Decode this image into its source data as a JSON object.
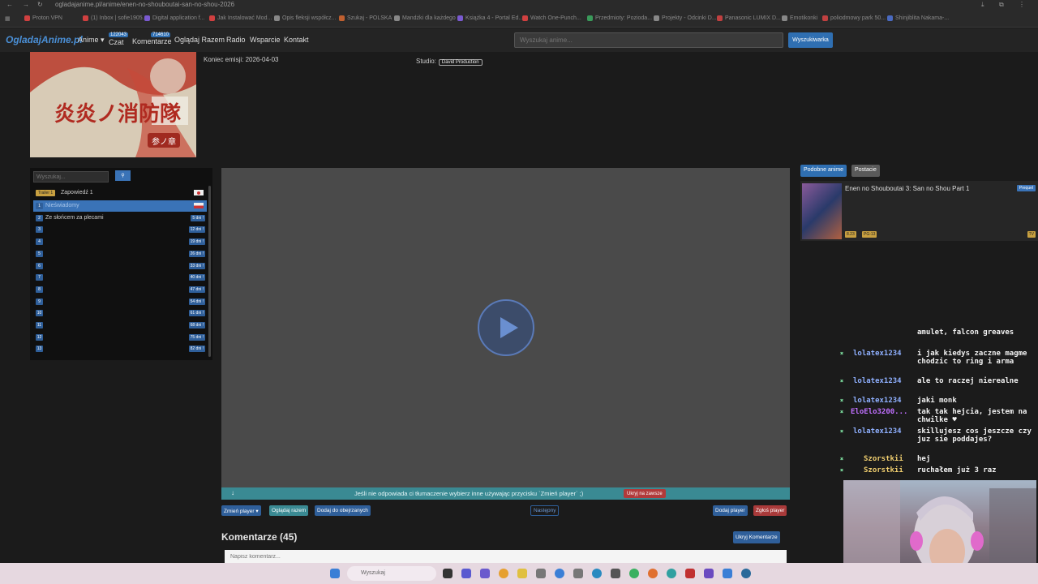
{
  "browser": {
    "url": "ogladajanime.pl/anime/enen-no-shouboutai-san-no-shou-2026",
    "bookmarks": [
      "Proton VPN",
      "(1) Inbox | sofie1905...",
      "Digital application f...",
      "Jak Instalować Mod...",
      "Opis fleksji współcz...",
      "Szukaj - POLSKA",
      "Mandżki dla każdego",
      "Książka 4 - Portal Ed...",
      "Watch One-Punch...",
      "Przedmioty: Pozioda...",
      "Projekty - Odcinki D...",
      "Panasonic LUMIX D...",
      "Emotikonki",
      "poliodmowy park 50...",
      "Shinjiblita Nakama-..."
    ]
  },
  "nav": {
    "logo": "OgladajAnime.pl",
    "anime": "Anime ▾",
    "chat": "Czat",
    "chat_count": "122043",
    "comments": "Komentarze",
    "comments_count": "714610",
    "watch_together": "Oglądaj Razem",
    "radio": "Radio",
    "support": "Wsparcie",
    "contact": "Kontakt",
    "search_placeholder": "Wyszukaj anime...",
    "search_button": "Wyszukiwarka"
  },
  "anime": {
    "end_date": "Koniec emisji: 2026-04-03",
    "studio_label": "Studio:",
    "studio": "David Production",
    "poster_text": "炎炎ノ消防隊",
    "poster_sub": "参ノ章"
  },
  "episodes": {
    "search_placeholder": "Wyszukaj...",
    "trailer_badge": "Trailer 1",
    "trailer_title": "Zapowiedź 1",
    "items": [
      {
        "num": "1",
        "title": "Nieświadomy",
        "days": ""
      },
      {
        "num": "2",
        "title": "Ze słońcem za plecami",
        "days": "5 dni !"
      },
      {
        "num": "3",
        "title": "",
        "days": "12 dni !"
      },
      {
        "num": "4",
        "title": "",
        "days": "19 dni !"
      },
      {
        "num": "5",
        "title": "",
        "days": "26 dni !"
      },
      {
        "num": "6",
        "title": "",
        "days": "33 dni !"
      },
      {
        "num": "7",
        "title": "",
        "days": "40 dni !"
      },
      {
        "num": "8",
        "title": "",
        "days": "47 dni !"
      },
      {
        "num": "9",
        "title": "",
        "days": "54 dni !"
      },
      {
        "num": "10",
        "title": "",
        "days": "61 dni !"
      },
      {
        "num": "11",
        "title": "",
        "days": "68 dni !"
      },
      {
        "num": "12",
        "title": "",
        "days": "75 dni !"
      },
      {
        "num": "13",
        "title": "",
        "days": "82 dni !"
      }
    ]
  },
  "player": {
    "info": "Jeśli nie odpowiada ci tłumaczenie wybierz inne używając przycisku `Zmień player` ;)",
    "info_arrow": "↓",
    "hide_forever": "Ukryj na zawsze",
    "change_player": "Zmień player ▾",
    "watch_together": "Oglądaj razem",
    "add_watched": "Dodaj do obejrzanych",
    "next": "Następny",
    "add_player": "Dodaj player",
    "report_player": "Zgłoś player"
  },
  "comments": {
    "title": "Komentarze (45)",
    "hide": "Ukryj Komentarze",
    "placeholder": "Napisz komentarz..."
  },
  "side": {
    "tab_similar": "Podobne anime",
    "tab_characters": "Postacie",
    "similar_title": "Enen no Shouboutai 3: San no Shou Part 1",
    "prequel": "Prequel",
    "rating": "8.23",
    "age": "PG-13",
    "type": "TV"
  },
  "stream_chat": [
    {
      "user": "",
      "msg": "amulet, falcon greaves"
    },
    {
      "user": "lolatex1234",
      "msg": "i jak kiedys zaczne magme chodzic to ring i arma"
    },
    {
      "user": "lolatex1234",
      "msg": "ale to raczej nierealne"
    },
    {
      "user": "lolatex1234",
      "msg": "jaki monk"
    },
    {
      "user": "EloElo3200...",
      "msg": "tak tak hejcia, jestem na chwilke ♥"
    },
    {
      "user": "lolatex1234",
      "msg": "skillujesz cos jeszcze czy juz sie poddajes?"
    },
    {
      "user": "Szorstkii",
      "msg": "hej"
    },
    {
      "user": "Szorstkii",
      "msg": "ruchałem już 3 raz"
    }
  ],
  "taskbar": {
    "search": "Wyszukaj"
  },
  "colors": {
    "accent": "#2f6fb2",
    "info_bar": "#3a8a93",
    "danger": "#b13a3a"
  }
}
